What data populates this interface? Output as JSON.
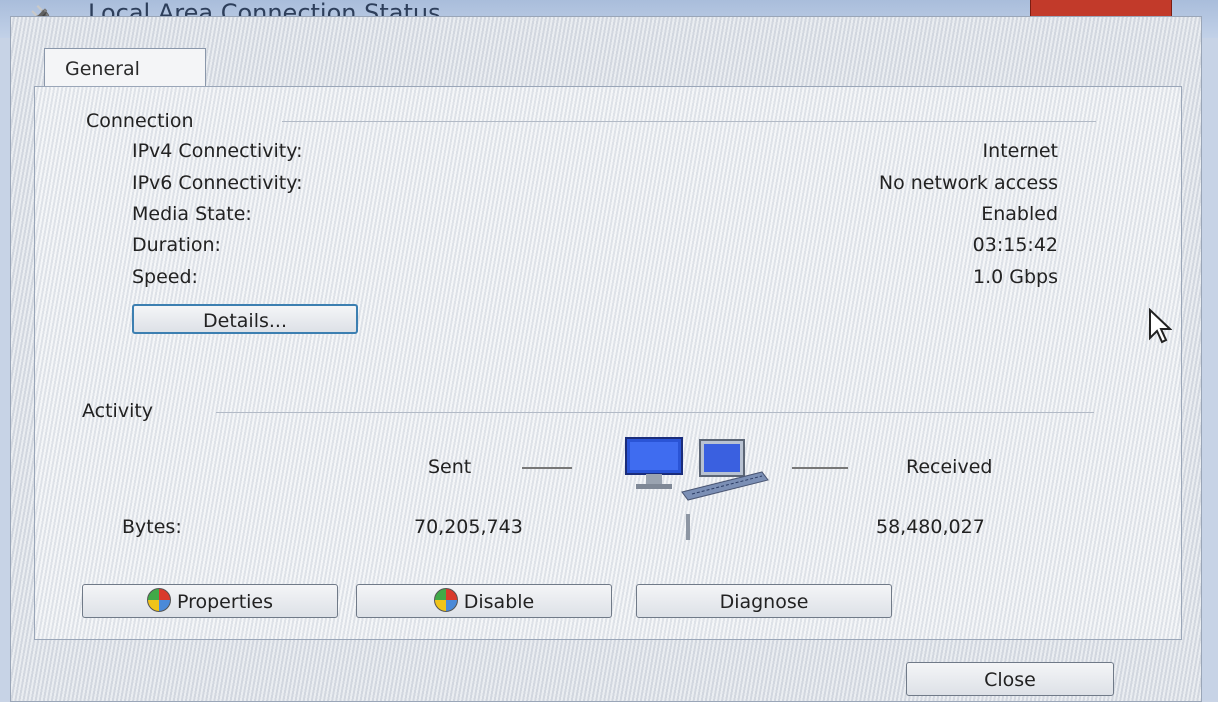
{
  "window": {
    "title": "Local Area Connection Status"
  },
  "tabs": [
    {
      "label": "General"
    }
  ],
  "connection": {
    "group_label": "Connection",
    "rows": [
      {
        "label": "IPv4 Connectivity:",
        "value": "Internet"
      },
      {
        "label": "IPv6 Connectivity:",
        "value": "No network access"
      },
      {
        "label": "Media State:",
        "value": "Enabled"
      },
      {
        "label": "Duration:",
        "value": "03:15:42"
      },
      {
        "label": "Speed:",
        "value": "1.0 Gbps"
      }
    ],
    "details_button": "Details..."
  },
  "activity": {
    "group_label": "Activity",
    "sent_label": "Sent",
    "received_label": "Received",
    "bytes_label": "Bytes:",
    "bytes_sent": "70,205,743",
    "bytes_received": "58,480,027"
  },
  "buttons": {
    "properties": "Properties",
    "disable": "Disable",
    "diagnose": "Diagnose",
    "close": "Close"
  },
  "icons": {
    "title": "network-adapter-icon",
    "network": "network-computers-icon",
    "shield": "uac-shield-icon"
  },
  "colors": {
    "close_button": "#c23a2a",
    "focus_border": "#3c7fb1"
  }
}
